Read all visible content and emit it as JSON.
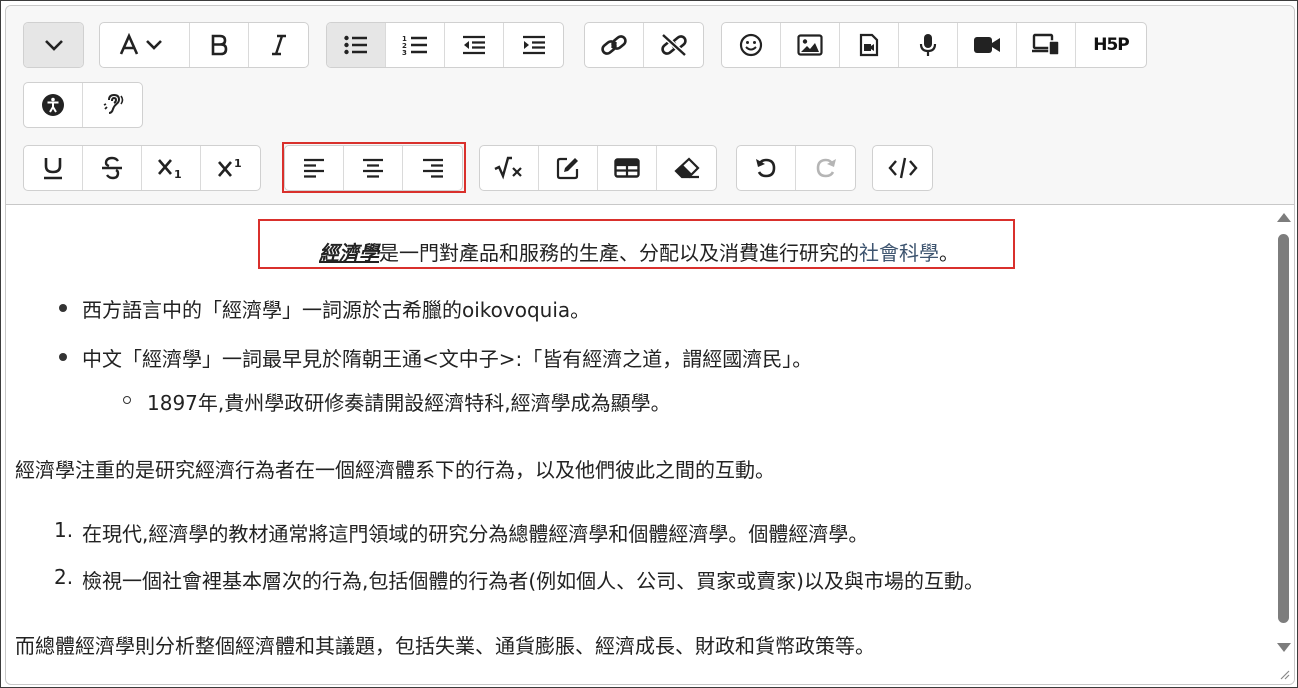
{
  "toolbar": {
    "row1": [
      {
        "name": "collapse-toggle-button",
        "icon": "chevron-down-icon",
        "active": true
      },
      {
        "name": "font-color-button",
        "icon": "font-color-icon"
      },
      {
        "name": "bold-button",
        "icon": "bold-icon"
      },
      {
        "name": "italic-button",
        "icon": "italic-icon"
      },
      {
        "name": "bullet-list-button",
        "icon": "bullet-list-icon",
        "active": true
      },
      {
        "name": "numbered-list-button",
        "icon": "numbered-list-icon"
      },
      {
        "name": "outdent-button",
        "icon": "outdent-icon"
      },
      {
        "name": "indent-button",
        "icon": "indent-icon"
      },
      {
        "name": "link-button",
        "icon": "link-icon"
      },
      {
        "name": "unlink-button",
        "icon": "unlink-icon"
      },
      {
        "name": "emoji-button",
        "icon": "emoji-icon"
      },
      {
        "name": "image-button",
        "icon": "image-icon"
      },
      {
        "name": "media-button",
        "icon": "media-file-icon"
      },
      {
        "name": "record-audio-button",
        "icon": "microphone-icon"
      },
      {
        "name": "record-video-button",
        "icon": "video-camera-icon"
      },
      {
        "name": "screen-record-button",
        "icon": "screen-icon"
      },
      {
        "name": "h5p-button",
        "icon": "h5p-icon",
        "label": "H5P"
      }
    ],
    "row2": [
      {
        "name": "accessibility-checker-button",
        "icon": "accessibility-icon"
      },
      {
        "name": "screenreader-helper-button",
        "icon": "hearing-icon"
      }
    ],
    "row3": [
      {
        "name": "underline-button",
        "icon": "underline-icon"
      },
      {
        "name": "strikethrough-button",
        "icon": "strikethrough-icon"
      },
      {
        "name": "subscript-button",
        "icon": "subscript-icon"
      },
      {
        "name": "superscript-button",
        "icon": "superscript-icon"
      },
      {
        "name": "align-left-button",
        "icon": "align-left-icon"
      },
      {
        "name": "align-center-button",
        "icon": "align-center-icon"
      },
      {
        "name": "align-right-button",
        "icon": "align-right-icon"
      },
      {
        "name": "equation-button",
        "icon": "equation-icon"
      },
      {
        "name": "special-character-button",
        "icon": "edit-icon"
      },
      {
        "name": "table-button",
        "icon": "table-icon"
      },
      {
        "name": "clear-formatting-button",
        "icon": "eraser-icon"
      },
      {
        "name": "undo-button",
        "icon": "undo-icon"
      },
      {
        "name": "redo-button",
        "icon": "redo-icon",
        "disabled": true
      },
      {
        "name": "html-button",
        "icon": "code-icon"
      }
    ]
  },
  "content": {
    "title_term": "經濟學",
    "title_middle": "是一門對產品和服務的生產、分配以及消費進行研究的",
    "title_link": "社會科學",
    "title_end": "。",
    "bullets": [
      "西方語言中的「經濟學」一詞源於古希臘的oikovoquia。",
      "中文「經濟學」一詞最早見於隋朝王通<文中子>:「皆有經濟之道，謂經國濟民」。"
    ],
    "sub_bullet": "1897年,貴州學政研修奏請開設經濟特科,經濟學成為顯學。",
    "paragraph1": "經濟學注重的是研究經濟行為者在一個經濟體系下的行為，以及他們彼此之間的互動。",
    "numbered": [
      {
        "num": "1.",
        "text": "在現代,經濟學的教材通常將這門領域的研究分為總體經濟學和個體經濟學。個體經濟學。"
      },
      {
        "num": "2.",
        "text": "檢視一個社會裡基本層次的行為,包括個體的行為者(例如個人、公司、買家或賣家)以及與市場的互動。"
      }
    ],
    "paragraph2": "而總體經濟學則分析整個經濟體和其議題，包括失業、通貨膨脹、經濟成長、財政和貨幣政策等。"
  },
  "colors": {
    "highlight": "#d9302c",
    "link": "#3e5570"
  }
}
